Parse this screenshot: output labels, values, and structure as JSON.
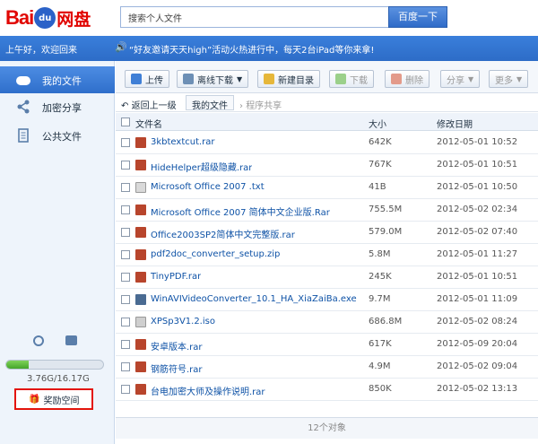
{
  "logo": {
    "bai": "Bai",
    "du": "du",
    "wangpan": "网盘"
  },
  "search": {
    "placeholder": "搜索个人文件",
    "button": "百度一下"
  },
  "topbar": {
    "greeting": "上午好，欢迎回来",
    "notice": "“好友邀请天天high”活动火热进行中，每天2台iPad等你来拿!"
  },
  "sidebar": {
    "items": [
      {
        "label": "我的文件",
        "icon": "cloud-icon"
      },
      {
        "label": "加密分享",
        "icon": "share-icon"
      },
      {
        "label": "公共文件",
        "icon": "document-icon"
      }
    ],
    "quota": {
      "used": "3.76G",
      "total": "16.17G",
      "text": "3.76G/16.17G",
      "fraction": 0.233
    },
    "reward": "奖励空间"
  },
  "toolbar": {
    "upload": "上传",
    "offline_download": "离线下载",
    "new_folder": "新建目录",
    "download": "下载",
    "delete": "删除",
    "share": "分享",
    "more": "更多"
  },
  "breadcrumb": {
    "back": "返回上一级",
    "current": "我的文件",
    "child": "程序共享"
  },
  "table": {
    "headers": {
      "name": "文件名",
      "size": "大小",
      "date": "修改日期"
    },
    "rows": [
      {
        "name": "3kbtextcut.rar",
        "size": "642K",
        "date": "2012-05-01 10:52",
        "type": "rar"
      },
      {
        "name": "HideHelper超级隐藏.rar",
        "size": "767K",
        "date": "2012-05-01 10:51",
        "type": "rar"
      },
      {
        "name": "Microsoft Office 2007 .txt",
        "size": "41B",
        "date": "2012-05-01 10:50",
        "type": "txt"
      },
      {
        "name": "Microsoft Office 2007 简体中文企业版.Rar",
        "size": "755.5M",
        "date": "2012-05-02 02:34",
        "type": "rar"
      },
      {
        "name": "Office2003SP2简体中文完整版.rar",
        "size": "579.0M",
        "date": "2012-05-02 07:40",
        "type": "rar"
      },
      {
        "name": "pdf2doc_converter_setup.zip",
        "size": "5.8M",
        "date": "2012-05-01 11:27",
        "type": "rar"
      },
      {
        "name": "TinyPDF.rar",
        "size": "245K",
        "date": "2012-05-01 10:51",
        "type": "rar"
      },
      {
        "name": "WinAVIVideoConverter_10.1_HA_XiaZaiBa.exe",
        "size": "9.7M",
        "date": "2012-05-01 11:09",
        "type": "exe"
      },
      {
        "name": "XPSp3V1.2.iso",
        "size": "686.8M",
        "date": "2012-05-02 08:24",
        "type": "iso"
      },
      {
        "name": "安卓版本.rar",
        "size": "617K",
        "date": "2012-05-09 20:04",
        "type": "rar"
      },
      {
        "name": "钢筋符号.rar",
        "size": "4.9M",
        "date": "2012-05-02 09:04",
        "type": "rar"
      },
      {
        "name": "台电加密大师及操作说明.rar",
        "size": "850K",
        "date": "2012-05-02 13:13",
        "type": "rar"
      }
    ]
  },
  "footer": {
    "count": "12个对象"
  },
  "colors": {
    "brand_red": "#e10602",
    "brand_blue": "#2b62c8",
    "link": "#0e52a6"
  }
}
